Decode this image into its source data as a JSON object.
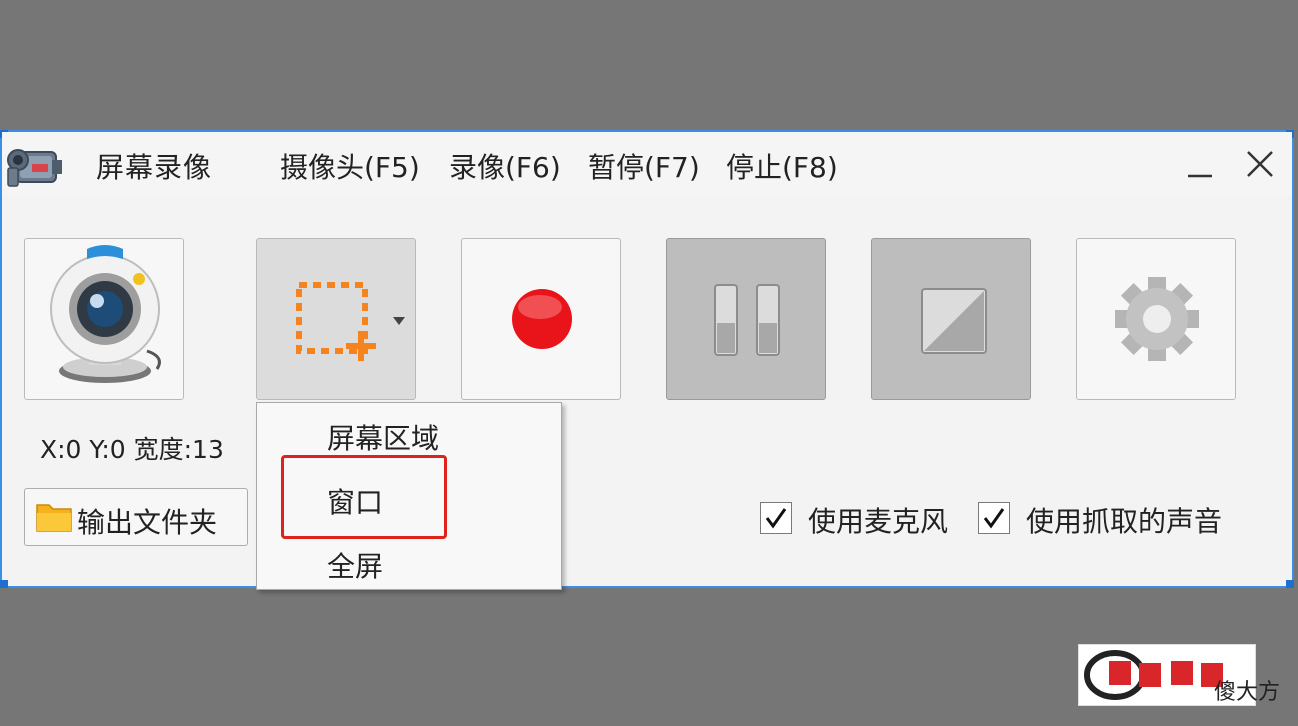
{
  "window": {
    "title": "屏幕录像",
    "menu": [
      {
        "id": "camera",
        "label": "摄像头(F5)"
      },
      {
        "id": "record",
        "label": "录像(F6)"
      },
      {
        "id": "pause",
        "label": "暂停(F7)"
      },
      {
        "id": "stop",
        "label": "停止(F8)"
      }
    ]
  },
  "toolbar": {
    "buttons": [
      {
        "id": "camera",
        "icon": "webcam-icon",
        "state": "normal"
      },
      {
        "id": "select-region",
        "icon": "region-select-icon",
        "state": "pressed",
        "has_dropdown": true
      },
      {
        "id": "record",
        "icon": "record-icon",
        "state": "normal"
      },
      {
        "id": "pause",
        "icon": "pause-icon",
        "state": "disabled"
      },
      {
        "id": "stop",
        "icon": "stop-icon",
        "state": "disabled"
      },
      {
        "id": "settings",
        "icon": "gear-icon",
        "state": "normal"
      }
    ]
  },
  "status": {
    "coords": "X:0 Y:0 宽度:13"
  },
  "output_folder": {
    "label": "输出文件夹"
  },
  "dropdown": {
    "items": [
      {
        "label": "屏幕区域",
        "highlighted": false
      },
      {
        "label": "窗口",
        "highlighted": true
      },
      {
        "label": "全屏",
        "highlighted": false
      }
    ]
  },
  "options": {
    "microphone": {
      "label": "使用麦克风",
      "checked": true
    },
    "system_audio": {
      "label": "使用抓取的声音",
      "checked": true
    }
  },
  "watermark": {
    "text": "傻大方"
  },
  "colors": {
    "window_border": "#3b8fe6",
    "highlight": "#e0231a",
    "record_red": "#e8141a",
    "region_orange": "#f5841f",
    "backdrop": "#767676"
  }
}
